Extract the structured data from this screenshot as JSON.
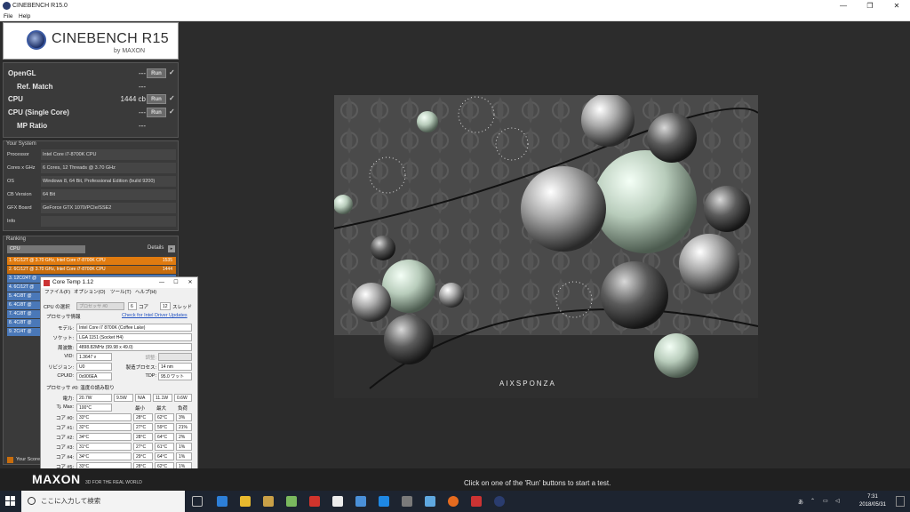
{
  "window": {
    "title": "CINEBENCH R15.0",
    "menu": [
      "File",
      "Help"
    ]
  },
  "logo": {
    "name": "CINEBENCH R15",
    "by": "by MAXON"
  },
  "benchmarks": [
    {
      "label": "OpenGL",
      "value": "---",
      "run": "Run",
      "check": "✓"
    },
    {
      "label": "Ref. Match",
      "value": "---"
    },
    {
      "label": "CPU",
      "value": "1444 cb",
      "run": "Run",
      "check": "✓"
    },
    {
      "label": "CPU (Single Core)",
      "value": "---",
      "run": "Run",
      "check": "✓"
    },
    {
      "label": "MP Ratio",
      "value": "---"
    }
  ],
  "your_system": {
    "title": "Your System",
    "rows": [
      {
        "label": "Processor",
        "value": "Intel Core i7-8700K CPU"
      },
      {
        "label": "Cores x GHz",
        "value": "6 Cores, 12 Threads @ 3.70 GHz"
      },
      {
        "label": "OS",
        "value": "Windows 8, 64 Bit, Professional Edition (build 9200)"
      },
      {
        "label": "CB Version",
        "value": "64 Bit"
      },
      {
        "label": "GFX Board",
        "value": "GeForce GTX 1070/PCIe/SSE2"
      },
      {
        "label": "Info",
        "value": ""
      }
    ]
  },
  "ranking": {
    "title": "Ranking",
    "select": "CPU",
    "details": "Details",
    "rows": [
      {
        "label": "1. 6C/12T @ 3.70 GHz, Intel Core i7-8700K CPU",
        "score": "1535",
        "color": "#e07b10"
      },
      {
        "label": "2. 6C/12T @ 3.70 GHz, Intel Core i7-8700K CPU",
        "score": "1444",
        "color": "#c86d0d"
      },
      {
        "label": "3. 12C/24T @",
        "score": "",
        "color": "#4a78b8"
      },
      {
        "label": "4. 6C/12T @",
        "score": "",
        "color": "#4a78b8"
      },
      {
        "label": "5. 4C/8T @",
        "score": "",
        "color": "#4a78b8"
      },
      {
        "label": "6. 4C/8T @",
        "score": "",
        "color": "#4a78b8"
      },
      {
        "label": "7. 4C/8T @",
        "score": "",
        "color": "#4a78b8"
      },
      {
        "label": "8. 4C/8T @",
        "score": "",
        "color": "#4a78b8"
      },
      {
        "label": "9. 2C/4T @",
        "score": "",
        "color": "#4a78b8"
      }
    ],
    "your_score": "Your Score"
  },
  "footer": {
    "brand": "MAXON",
    "tagline": "3D FOR THE REAL WORLD",
    "hint": "Click on one of the 'Run' buttons to start a test."
  },
  "render": {
    "watermark": "AIXSPONZA"
  },
  "coretemp": {
    "title": "Core Temp 1.12",
    "menu": [
      "ファイル(F)",
      "オプション(O)",
      "ツール(T)",
      "ヘルプ(H)"
    ],
    "cpu_select_label": "CPU の選択",
    "processor_select": "プロセッサ #0",
    "cores_value": "6",
    "cores_label": "コア",
    "threads_value": "12",
    "threads_label": "スレッド",
    "proc_info_label": "プロセッサ情報",
    "driver_link": "Check for Intel Driver Updates",
    "model_label": "モデル:",
    "model_value": "Intel Core i7 8700K (Coffee Lake)",
    "socket_label": "ソケット:",
    "socket_value": "LGA 1151 (Socket H4)",
    "freq_label": "周波数:",
    "freq_value": "4898.82MHz (99.98 x 49.0)",
    "vid_label": "VID:",
    "vid_value": "1.3647 v",
    "mod_label": "調整:",
    "rev_label": "リビジョン:",
    "rev_value": "U0",
    "lith_label": "製造プロセス:",
    "lith_value": "14 nm",
    "cpuid_label": "CPUID:",
    "cpuid_value": "0x906EA",
    "tdp_label": "TDP:",
    "tdp_value": "95.0 ワット",
    "temp_header": "プロセッサ #0: 温度の読み取り",
    "power_label": "電力:",
    "power_values": [
      "20.7W",
      "9.5W",
      "N/A",
      "11.1W",
      "0.6W"
    ],
    "tjmax_label": "Tj. Max:",
    "tjmax_value": "100°C",
    "col_min": "最小",
    "col_max": "最大",
    "col_load": "負荷",
    "cores": [
      {
        "label": "コア #0:",
        "temp": "33°C",
        "min": "28°C",
        "max": "62°C",
        "load": "3%"
      },
      {
        "label": "コア #1:",
        "temp": "32°C",
        "min": "27°C",
        "max": "59°C",
        "load": "21%"
      },
      {
        "label": "コア #2:",
        "temp": "34°C",
        "min": "28°C",
        "max": "64°C",
        "load": "2%"
      },
      {
        "label": "コア #3:",
        "temp": "31°C",
        "min": "27°C",
        "max": "61°C",
        "load": "1%"
      },
      {
        "label": "コア #4:",
        "temp": "34°C",
        "min": "29°C",
        "max": "64°C",
        "load": "1%"
      },
      {
        "label": "コア #5:",
        "temp": "33°C",
        "min": "28°C",
        "max": "62°C",
        "load": "1%"
      }
    ]
  },
  "taskbar": {
    "search_placeholder": "ここに入力して検索",
    "time": "7:31",
    "date": "2018/05/31",
    "ime": "あ"
  }
}
